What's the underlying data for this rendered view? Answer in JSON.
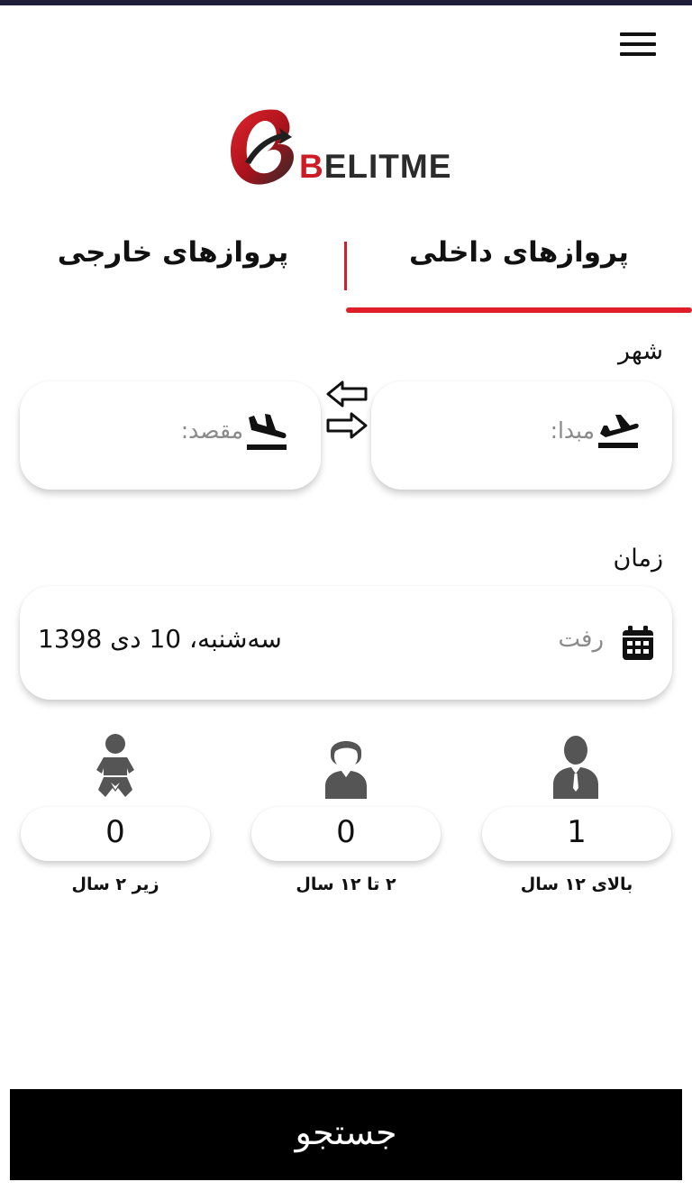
{
  "brand": {
    "logo_text_first": "B",
    "logo_text_rest": "ELITME",
    "accent_color": "#e01e29"
  },
  "tabs": {
    "domestic": "پروازهای داخلی",
    "foreign": "پروازهای خارجی",
    "active": "domestic"
  },
  "city_section": {
    "label": "شهر",
    "origin_placeholder": "مبدا:",
    "destination_placeholder": "مقصد:"
  },
  "time_section": {
    "label": "زمان",
    "departure_label": "رفت",
    "departure_date": "سه‌شنبه، 10 دی 1398"
  },
  "passengers": {
    "adult": {
      "count": "1",
      "label": "بالای ۱۲ سال",
      "icon": "adult-icon"
    },
    "child": {
      "count": "0",
      "label": "۲ تا ۱۲ سال",
      "icon": "child-icon"
    },
    "infant": {
      "count": "0",
      "label": "زیر ۲ سال",
      "icon": "infant-icon"
    }
  },
  "search_button": "جستجو"
}
